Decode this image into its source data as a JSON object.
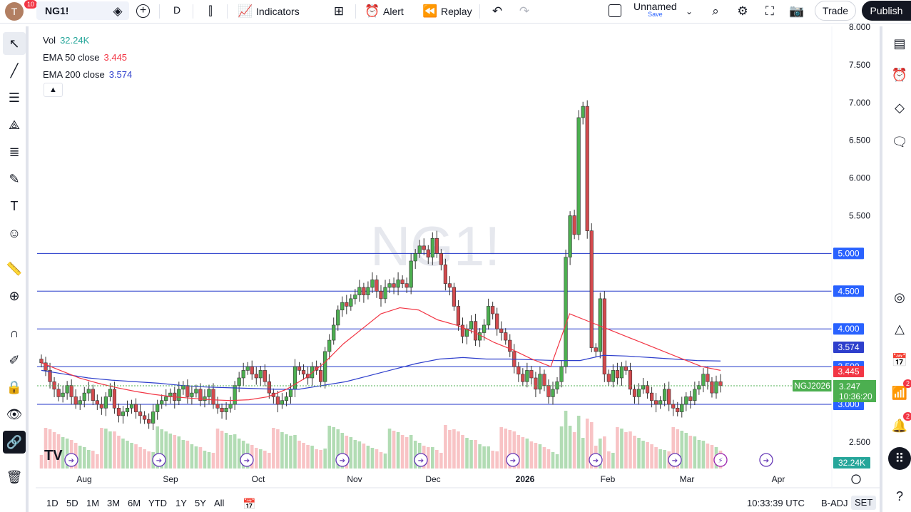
{
  "header": {
    "avatar_initial": "T",
    "notification_count": "10",
    "symbol": "NG1!",
    "interval": "D",
    "indicators_label": "Indicators",
    "alert_label": "Alert",
    "replay_label": "Replay",
    "layout_name": "Unnamed",
    "layout_save": "Save",
    "trade_label": "Trade",
    "publish_label": "Publish"
  },
  "legend": {
    "vol_label": "Vol",
    "vol_value": "32.24K",
    "ema50_label": "EMA 50 close",
    "ema50_value": "3.445",
    "ema200_label": "EMA 200 close",
    "ema200_value": "3.574",
    "collapse_icon": "chevron-up"
  },
  "watermark": "NG1!",
  "price_axis": {
    "ticks": [
      "8.000",
      "7.500",
      "7.000",
      "6.500",
      "6.000",
      "5.500",
      "2.500"
    ],
    "hlines": [
      "5.000",
      "4.500",
      "4.000",
      "3.500",
      "3.000"
    ],
    "ema200_tag": "3.574",
    "ema50_tag": "3.445",
    "symbol_tag": "NGJ2026",
    "last_price": "3.247",
    "countdown": "10:36:20",
    "volume_tag": "32.24K"
  },
  "time_axis": [
    "Aug",
    "Sep",
    "Oct",
    "Nov",
    "Dec",
    "2026",
    "Feb",
    "Mar",
    "Apr"
  ],
  "bottom": {
    "ranges": [
      "1D",
      "5D",
      "1M",
      "3M",
      "6M",
      "YTD",
      "1Y",
      "5Y",
      "All"
    ],
    "clock": "10:33:39 UTC",
    "adj": "B-ADJ",
    "session": "SET"
  },
  "right_badges": {
    "alerts": "2",
    "notifications": "2"
  },
  "colors": {
    "up": "#4caf50",
    "down": "#d44a4e",
    "ema50": "#f23645",
    "ema200": "#2e3fcc",
    "hline": "#2136c9",
    "tag_blue": "#2962ff",
    "tag_green": "#4caf50"
  },
  "chart_data": {
    "type": "candlestick",
    "title": "NG1!",
    "x_range": [
      "Jul",
      "Apr"
    ],
    "ylim": [
      2.5,
      8.0
    ],
    "closes": [
      3.55,
      3.45,
      3.3,
      3.2,
      3.1,
      3.15,
      3.25,
      3.1,
      3.0,
      3.05,
      3.15,
      3.2,
      3.05,
      3.0,
      2.95,
      3.1,
      3.2,
      2.95,
      2.85,
      2.9,
      2.95,
      3.0,
      2.9,
      2.85,
      2.8,
      2.75,
      2.9,
      3.0,
      3.05,
      3.1,
      3.15,
      3.05,
      3.2,
      3.25,
      3.1,
      3.15,
      3.2,
      3.05,
      3.1,
      3.2,
      3.0,
      2.95,
      2.9,
      2.95,
      3.0,
      3.25,
      3.35,
      3.45,
      3.5,
      3.4,
      3.35,
      3.45,
      3.3,
      3.15,
      3.1,
      3.0,
      3.05,
      3.1,
      3.2,
      3.5,
      3.45,
      3.4,
      3.35,
      3.5,
      3.45,
      3.3,
      3.7,
      3.85,
      4.05,
      4.25,
      4.35,
      4.3,
      4.4,
      4.45,
      4.55,
      4.45,
      4.55,
      4.65,
      4.5,
      4.4,
      4.55,
      4.6,
      4.55,
      4.65,
      4.6,
      4.55,
      4.9,
      5.0,
      5.1,
      5.05,
      4.95,
      5.2,
      5.0,
      4.85,
      4.6,
      4.55,
      4.3,
      4.05,
      3.9,
      4.0,
      4.1,
      3.85,
      3.95,
      4.05,
      4.3,
      4.2,
      4.0,
      3.95,
      3.85,
      3.7,
      3.5,
      3.4,
      3.3,
      3.45,
      3.35,
      3.2,
      3.4,
      3.25,
      3.1,
      3.2,
      3.3,
      3.5,
      4.95,
      5.5,
      5.25,
      6.8,
      6.95,
      5.3,
      3.75,
      3.7,
      4.4,
      3.4,
      3.3,
      3.45,
      3.35,
      3.5,
      3.45,
      3.2,
      3.1,
      3.2,
      3.25,
      3.15,
      3.05,
      3.0,
      3.05,
      3.2,
      3.0,
      2.95,
      2.9,
      3.0,
      3.1,
      3.05,
      3.2,
      3.25,
      3.4,
      3.3,
      3.15,
      3.3,
      3.247
    ],
    "ema50": [
      3.55,
      3.45,
      3.35,
      3.28,
      3.22,
      3.17,
      3.13,
      3.1,
      3.08,
      3.06,
      3.05,
      3.06,
      3.1,
      3.2,
      3.35,
      3.55,
      3.8,
      4.0,
      4.2,
      4.28,
      4.25,
      4.12,
      4.05,
      3.95,
      3.82,
      3.72,
      3.6,
      3.5,
      4.2,
      4.1,
      4.0,
      3.9,
      3.8,
      3.7,
      3.6,
      3.5,
      3.45
    ],
    "ema200": [
      3.45,
      3.4,
      3.35,
      3.32,
      3.3,
      3.28,
      3.25,
      3.23,
      3.22,
      3.21,
      3.2,
      3.2,
      3.25,
      3.3,
      3.38,
      3.46,
      3.54,
      3.6,
      3.62,
      3.6,
      3.6,
      3.59,
      3.58,
      3.58,
      3.65,
      3.64,
      3.62,
      3.6,
      3.58,
      3.574
    ]
  }
}
